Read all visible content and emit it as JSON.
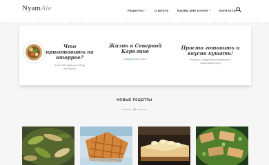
{
  "header": {
    "logo_main": "Nyam",
    "logo_script": "Ale",
    "nav": [
      {
        "label": "РЕЦЕПТЫ",
        "caret": "▾"
      },
      {
        "label": "О БЛОГЕ"
      },
      {
        "label": "ЖИЗНЬ ВНЕ КУХНИ",
        "caret": "▾"
      },
      {
        "label": "КОНТАКТЫ"
      }
    ]
  },
  "features": [
    {
      "title_lines": [
        "Что",
        "приготовить на",
        "вторрое?"
      ],
      "text_lines": [
        "Более 300 идей для обеду",
        "или ужина"
      ]
    },
    {
      "title_lines": [
        "Жизнь в Северной",
        "Каролине"
      ],
      "text_link": "Instagram",
      "text_rest": " вне кухни"
    },
    {
      "title_lines": [
        "Просто готовить и",
        "вкусно кушать!"
      ],
      "text_lines": [
        "Рецепты с подробным описанием и",
        "пошаговыми фото"
      ]
    }
  ],
  "recent": {
    "title": "НОВЫЕ РЕЦЕПТЫ"
  }
}
